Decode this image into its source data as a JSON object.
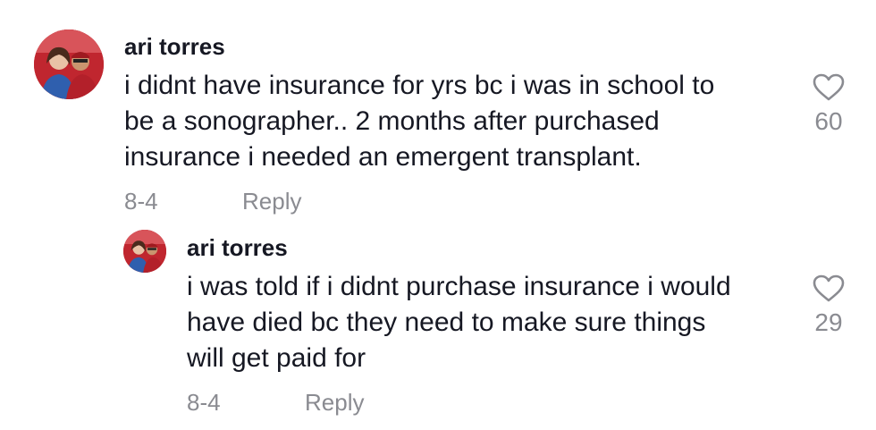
{
  "comments": [
    {
      "username": "ari torres",
      "text": "i didnt have insurance for yrs bc i was in school to\nbe a sonographer.. 2 months after purchased\ninsurance i needed an emergent transplant.",
      "date": "8-4",
      "reply_label": "Reply",
      "likes": "60"
    },
    {
      "username": "ari torres",
      "text": "i was told if i didnt purchase insurance i would\nhave died bc they need to make sure things\nwill get paid for",
      "date": "8-4",
      "reply_label": "Reply",
      "likes": "29"
    }
  ],
  "icons": {
    "like": "heart-outline-icon",
    "avatar": "profile-photo"
  },
  "colors": {
    "text": "#161823",
    "muted": "#8a8b91",
    "background": "#ffffff"
  }
}
